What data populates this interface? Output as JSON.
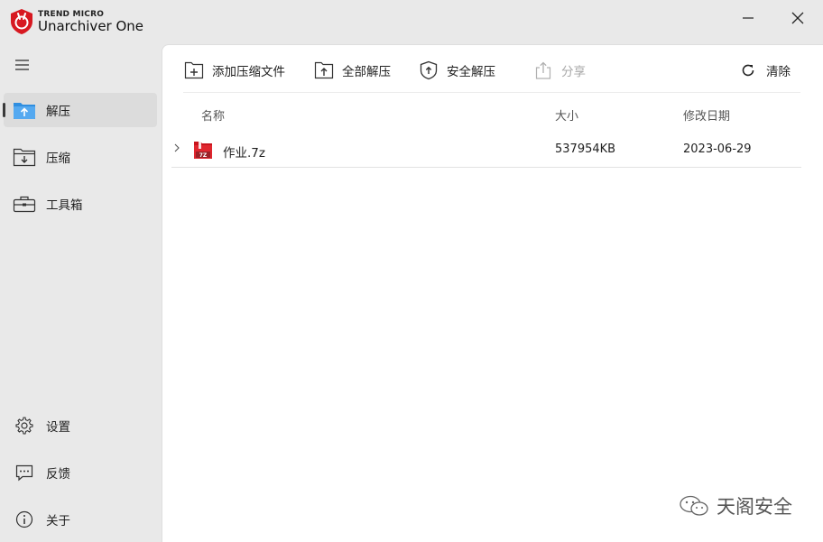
{
  "app": {
    "brand_top": "TREND MICRO",
    "title": "Unarchiver One",
    "accent_color": "#d71921"
  },
  "window_controls": {
    "minimize_icon": "minimize-icon",
    "close_icon": "close-icon"
  },
  "sidebar": {
    "menu_icon": "hamburger-menu-icon",
    "items": [
      {
        "label": "解压",
        "icon": "extract-folder-icon",
        "active": true
      },
      {
        "label": "压缩",
        "icon": "compress-folder-icon",
        "active": false
      },
      {
        "label": "工具箱",
        "icon": "toolbox-icon",
        "active": false
      }
    ],
    "bottom_items": [
      {
        "label": "设置",
        "icon": "gear-icon"
      },
      {
        "label": "反馈",
        "icon": "feedback-chat-icon"
      },
      {
        "label": "关于",
        "icon": "info-icon"
      }
    ]
  },
  "toolbar": {
    "add_label": "添加压缩文件",
    "extract_all_label": "全部解压",
    "safe_extract_label": "安全解压",
    "share_label": "分享",
    "clear_label": "清除"
  },
  "table": {
    "columns": [
      "名称",
      "大小",
      "修改日期"
    ],
    "rows": [
      {
        "name": "作业.7z",
        "size": "537954KB",
        "date": "2023-06-29",
        "icon": "7z-archive-icon",
        "icon_label": "7Z"
      }
    ]
  },
  "watermark": {
    "text": "天阁安全"
  }
}
